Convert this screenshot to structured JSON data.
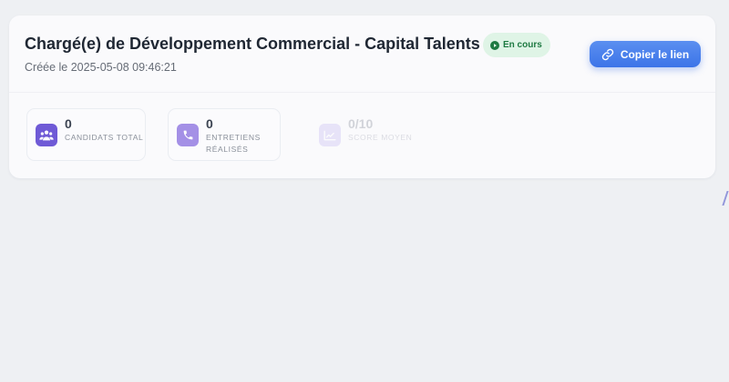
{
  "job": {
    "title": "Chargé(e) de Développement Commercial - Capital Talents",
    "status_label": "En cours",
    "created_label": "Créée le 2025-05-08 09:46:21",
    "copy_link_label": "Copier le lien"
  },
  "stats": [
    {
      "value": "0",
      "label": "Candidats total",
      "icon": "users-icon"
    },
    {
      "value": "0",
      "label": "Entretiens réalisés",
      "icon": "phone-icon"
    },
    {
      "value": "0/10",
      "label": "Score moyen",
      "icon": "chart-line-icon"
    }
  ],
  "colors": {
    "background": "#eef0f3",
    "card": "#fafafc",
    "accent_blue": "#3c74e8",
    "status_green": "#1e7a42",
    "status_bg": "#dff4e6",
    "stat_icon_purple": "#6f5ad6"
  }
}
